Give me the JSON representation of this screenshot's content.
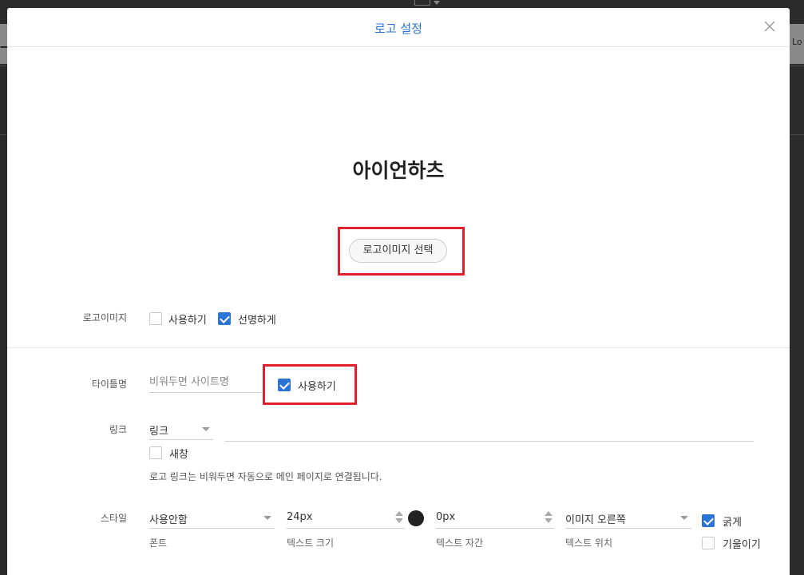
{
  "background": {
    "left_glyph": "ㅡ",
    "right_label": "Lo"
  },
  "modal": {
    "title": "로고 설정",
    "logo_preview_text": "아이언하츠",
    "logo_select_button": "로고이미지 선택"
  },
  "logo_image": {
    "label": "로고이미지",
    "use": {
      "label": "사용하기",
      "checked": false
    },
    "sharp": {
      "label": "선명하게",
      "checked": true
    }
  },
  "title_name": {
    "label": "타이틀명",
    "placeholder": "비워두면 사이트명",
    "value": "",
    "use": {
      "label": "사용하기",
      "checked": true
    }
  },
  "link": {
    "label": "링크",
    "type_value": "링크",
    "url_value": "",
    "new_window": {
      "label": "새창",
      "checked": false
    },
    "help": "로고 링크는 비워두면 자동으로 메인 페이지로 연결됩니다."
  },
  "style": {
    "label": "스타일",
    "font": {
      "value": "사용안함",
      "caption": "폰트"
    },
    "size": {
      "value": "24px",
      "caption": "텍스트 크기"
    },
    "color": "#222222",
    "spacing": {
      "value": "0px",
      "caption": "텍스트 자간"
    },
    "position": {
      "value": "이미지 오른쪽",
      "caption": "텍스트 위치"
    },
    "bold": {
      "label": "굵게",
      "checked": true
    },
    "italic": {
      "label": "기울이기",
      "checked": false
    }
  },
  "colors": {
    "accent": "#2a74d6",
    "highlight": "#e0202a"
  }
}
